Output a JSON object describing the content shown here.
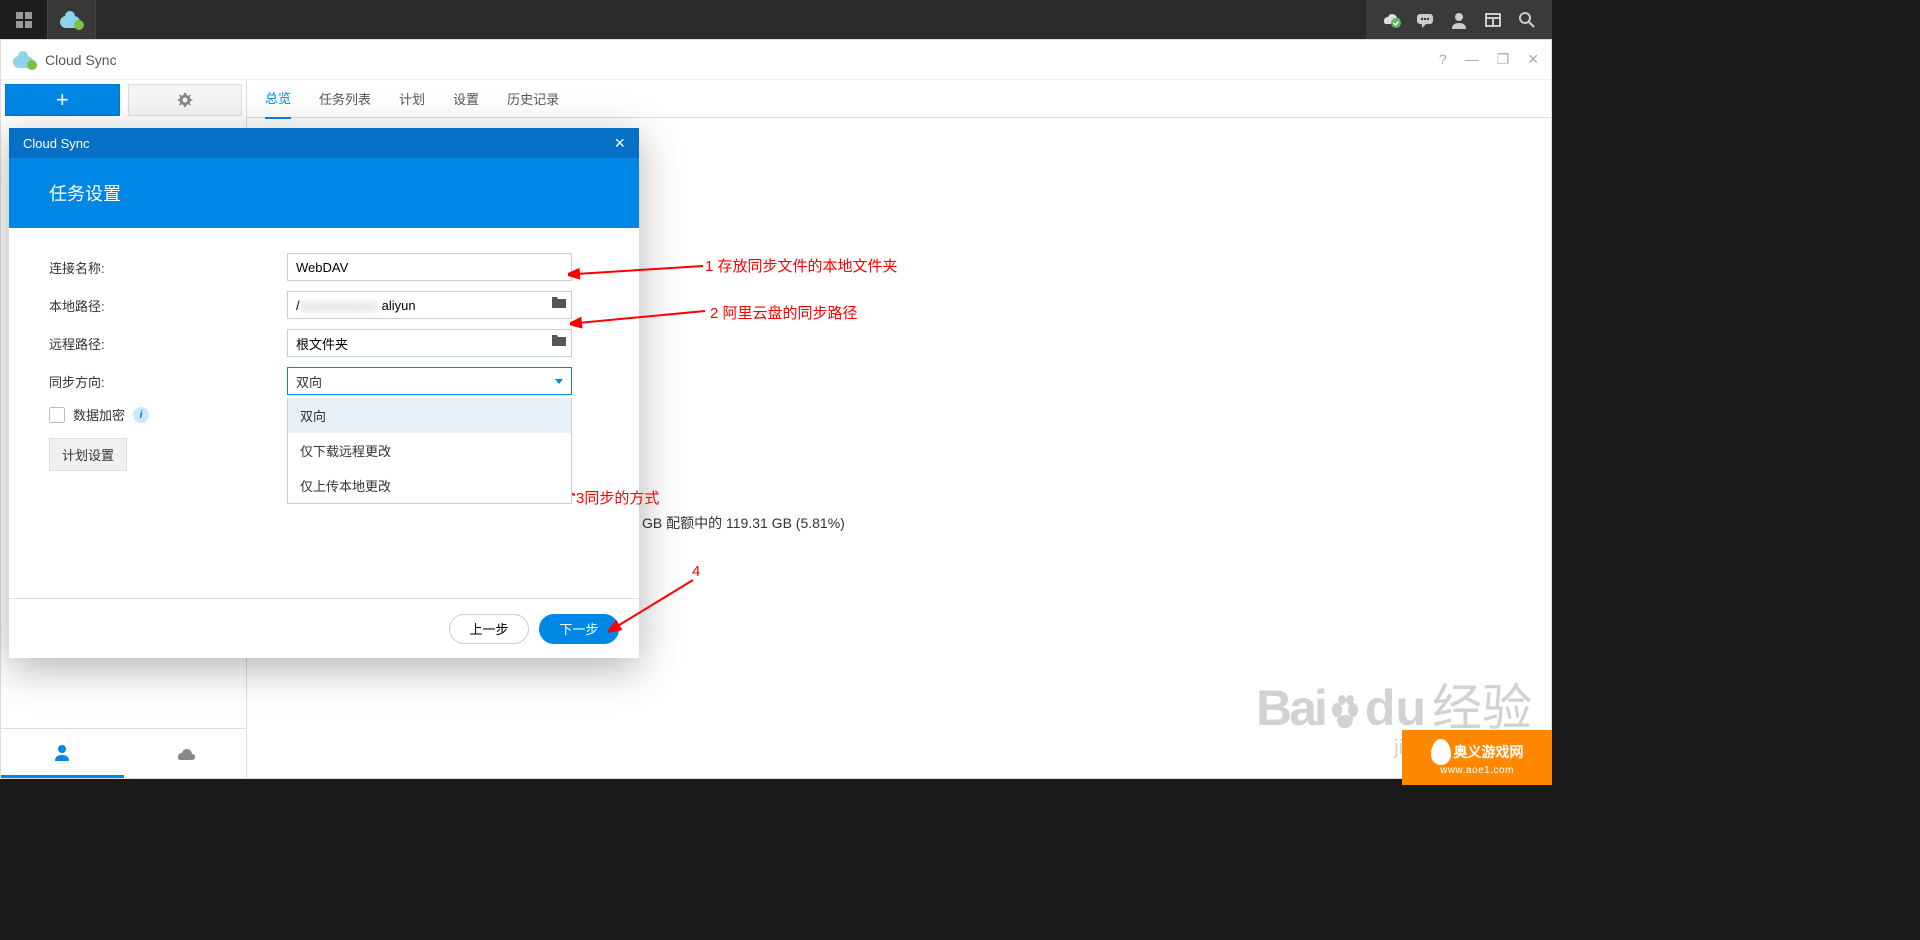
{
  "app": {
    "title": "Cloud Sync"
  },
  "nav_tabs": [
    "总览",
    "任务列表",
    "计划",
    "设置",
    "历史记录"
  ],
  "active_tab_index": 0,
  "modal": {
    "title": "Cloud Sync",
    "banner": "任务设置",
    "fields": {
      "connection_name_label": "连接名称:",
      "connection_name_value": "WebDAV",
      "local_path_label": "本地路径:",
      "local_path_prefix": "/",
      "local_path_value": "aliyun",
      "remote_path_label": "远程路径:",
      "remote_path_value": "根文件夹",
      "sync_direction_label": "同步方向:",
      "sync_direction_value": "双向",
      "sync_direction_options": [
        "双向",
        "仅下载远程更改",
        "仅上传本地更改"
      ],
      "encrypt_label": "数据加密",
      "schedule_btn": "计划设置"
    },
    "buttons": {
      "prev": "上一步",
      "next": "下一步"
    }
  },
  "quota_text": "GB 配额中的 119.31 GB (5.81%)",
  "annotations": {
    "a1": "1 存放同步文件的本地文件夹",
    "a2": "2 阿里云盘的同步路径",
    "a3": "3同步的方式",
    "a4": "4"
  },
  "watermark": {
    "main": "Baidu经验",
    "sub": "jingyan.baidu",
    "banner_text": "奥义游戏网",
    "banner_url": "www.aoe1.com"
  }
}
